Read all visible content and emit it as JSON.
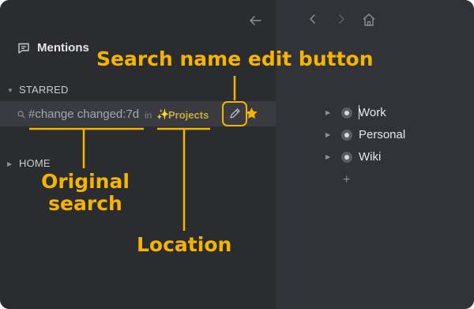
{
  "sidebar": {
    "back_icon": "arrow-left-icon",
    "mentions": {
      "icon": "message-square-icon",
      "label": "Mentions"
    },
    "starred": {
      "label": "STARRED",
      "search": {
        "query": "#change changed:7d",
        "in_label": "in",
        "location_icon": "sparkles-icon",
        "location_name": "Projects",
        "edit_icon": "pencil-icon",
        "star_icon": "star-icon"
      }
    },
    "home": {
      "label": "HOME"
    }
  },
  "main": {
    "nav": {
      "back_icon": "chevron-left-icon",
      "forward_icon": "chevron-right-icon",
      "home_icon": "home-icon"
    },
    "tree": [
      {
        "label": "Work"
      },
      {
        "label": "Personal"
      },
      {
        "label": "Wiki"
      }
    ],
    "add_label": "+"
  },
  "annotations": {
    "edit_button": "Search name edit button",
    "original_line1": "Original",
    "original_line2": "search",
    "location": "Location"
  },
  "colors": {
    "accent": "#f5b400",
    "sidebar_bg": "#2b2c30",
    "main_bg": "#313338",
    "row_highlight": "#393b40"
  }
}
